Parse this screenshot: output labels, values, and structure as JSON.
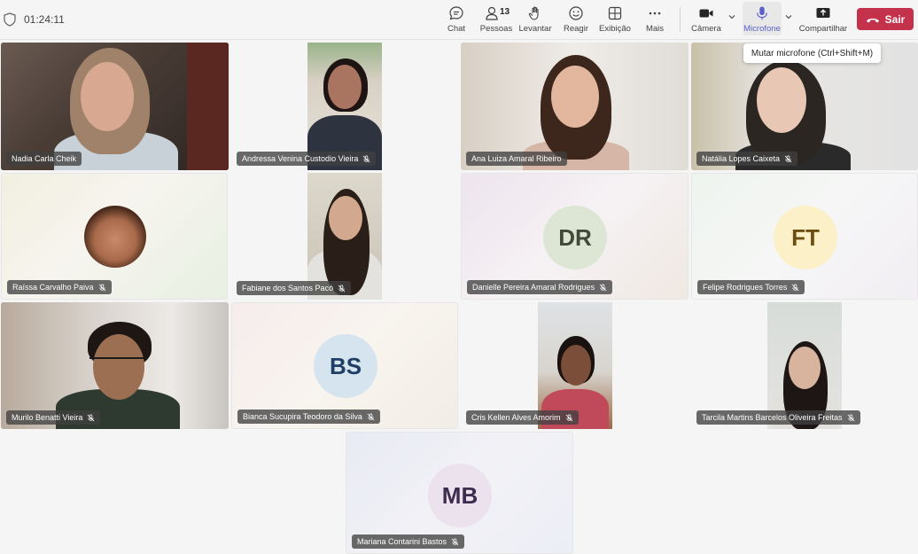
{
  "meeting": {
    "timer": "01:24:11"
  },
  "toolbar": {
    "chat": "Chat",
    "people": "Pessoas",
    "people_count": "13",
    "raise": "Levantar",
    "react": "Reagir",
    "view": "Exibição",
    "more": "Mais",
    "camera": "Câmera",
    "mic": "Microfone",
    "share": "Compartilhar",
    "leave": "Sair"
  },
  "tooltip": "Mutar microfone (Ctrl+Shift+M)",
  "participants": [
    {
      "name": "Nadia Carla Cheik",
      "muted": false
    },
    {
      "name": "Andressa Venina Custodio Vieira",
      "muted": true
    },
    {
      "name": "Ana Luiza Amaral Ribeiro",
      "muted": false
    },
    {
      "name": "Natália Lopes Caixeta",
      "muted": true
    },
    {
      "name": "Raíssa Carvalho Paiva",
      "muted": true
    },
    {
      "name": "Fabiane dos Santos Pacó",
      "muted": true
    },
    {
      "name": "Danielle Pereira Amaral Rodrigues",
      "muted": true,
      "initials": "DR"
    },
    {
      "name": "Felipe Rodrigues Torres",
      "muted": true,
      "initials": "FT"
    },
    {
      "name": "Murilo Benatti Vieira",
      "muted": true
    },
    {
      "name": "Bianca Sucupira Teodoro da Silva",
      "muted": true,
      "initials": "BS"
    },
    {
      "name": "Cris Kellen Alves Amorim",
      "muted": true
    },
    {
      "name": "Tarcila Martins Barcelos Oliveira Freitas",
      "muted": true
    },
    {
      "name": "Mariana Contarini Bastos",
      "muted": true,
      "initials": "MB"
    }
  ],
  "colors": {
    "accent": "#5b5fc7",
    "leave": "#c4314b"
  }
}
